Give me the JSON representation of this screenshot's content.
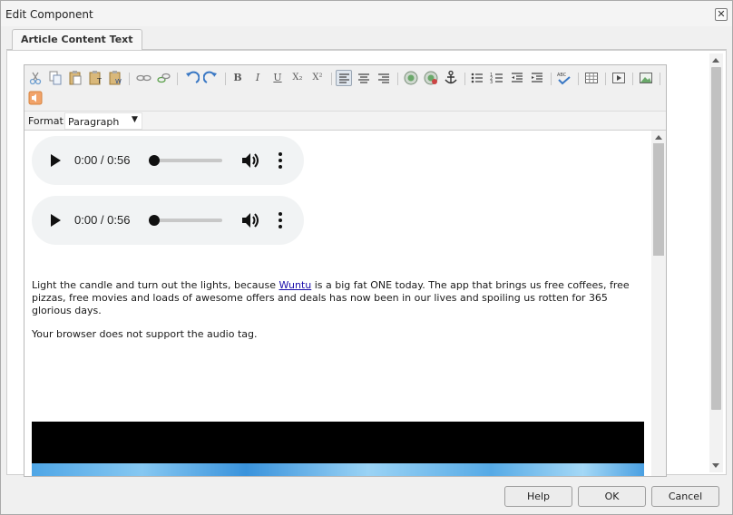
{
  "window": {
    "title": "Edit Component",
    "close_label": "✕"
  },
  "tabs": [
    {
      "label": "Article Content Text"
    }
  ],
  "toolbar": {
    "format_label": "Format",
    "format_value": "Paragraph",
    "buttons": [
      "cut-icon",
      "copy-icon",
      "paste-icon",
      "paste-plain-text-icon",
      "paste-from-word-icon",
      "unlink-icon",
      "link-icon",
      "undo-icon",
      "redo-icon",
      "bold-icon",
      "italic-icon",
      "underline-icon",
      "subscript-icon",
      "superscript-icon",
      "align-left-icon",
      "align-center-icon",
      "align-right-icon",
      "image-map-icon",
      "anchor-link-icon",
      "anchor-icon",
      "bulleted-list-icon",
      "numbered-list-icon",
      "outdent-icon",
      "indent-icon",
      "spellcheck-icon",
      "table-icon",
      "video-embed-icon",
      "image-icon",
      "audio-embed-icon"
    ],
    "glyphs": {
      "bold": "B",
      "italic": "I",
      "underline": "U",
      "subscript": "X₂",
      "superscript": "X²",
      "spellcheck": "ABC"
    }
  },
  "content": {
    "audio_players": [
      {
        "time": "0:00 / 0:56",
        "progress": 0
      },
      {
        "time": "0:00 / 0:56",
        "progress": 0
      }
    ],
    "paragraph": {
      "before_link": "Light the candle and turn out the lights, because ",
      "link_text": "Wuntu",
      "after_link": " is a big fat ONE today. The app that brings us free coffees, free pizzas, free movies and loads of awesome offers and deals has now been in our lives and spoiling us rotten for 365 glorious days."
    },
    "fallback_text": "Your browser does not support the audio tag."
  },
  "footer": {
    "help_label": "Help",
    "ok_label": "OK",
    "cancel_label": "Cancel"
  },
  "colors": {
    "link": "#1a0dab",
    "audio_bg": "#f1f3f4",
    "video_bg": "#000000"
  }
}
